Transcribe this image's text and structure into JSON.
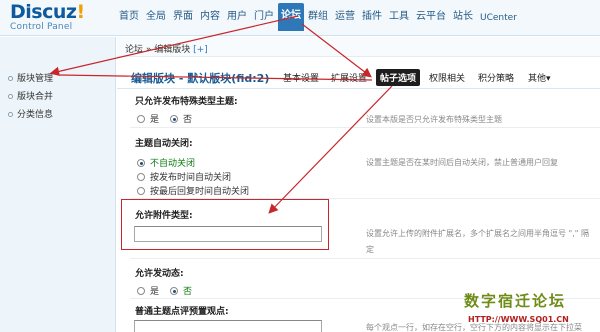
{
  "logo": {
    "main": "Discuz",
    "bang": "!",
    "sub": "Control Panel"
  },
  "topnav": [
    "首页",
    "全局",
    "界面",
    "内容",
    "用户",
    "门户",
    "论坛",
    "群组",
    "运营",
    "插件",
    "工具",
    "云平台",
    "站长",
    "UCenter"
  ],
  "sidebar": {
    "items": [
      "版块管理",
      "版块合并",
      "分类信息"
    ]
  },
  "breadcrumb": {
    "path": "论坛 » 编辑版块",
    "plus": "[+]"
  },
  "page_title": "编辑版块 - 默认版块(fid:2)",
  "tabs": [
    "基本设置",
    "扩展设置",
    "帖子选项",
    "权限相关",
    "积分策略",
    "其他▾"
  ],
  "form": {
    "special_type": {
      "label": "只允许发布特殊类型主题:",
      "yes": "是",
      "no": "否",
      "desc": "设置本版是否只允许发布特殊类型主题"
    },
    "auto_close": {
      "label": "主题自动关闭:",
      "options": [
        "不自动关闭",
        "按发布时间自动关闭",
        "按最后回复时间自动关闭"
      ],
      "desc": "设置主题是否在某时间后自动关闭，禁止普通用户回复"
    },
    "attach_types": {
      "label": "允许附件类型:",
      "value": "",
      "desc": "设置允许上传的附件扩展名，多个扩展名之间用半角逗号 \",\" 隔",
      "desc2": "定"
    },
    "allow_feed": {
      "label": "允许发动态:",
      "yes": "是",
      "no": "否"
    },
    "viewpoints": {
      "label": "普通主题点评预置观点:",
      "desc": "每个观点一行，如存在空行，空行下方的内容将显示在下拉菜"
    }
  },
  "watermark": {
    "title": "数字宿迁论坛",
    "url": "HTTP://WWW.SQ01.CN"
  },
  "colors": {
    "annotation_red": "#c7262a",
    "active_nav": "#2f78b8",
    "active_tab": "#1d1d1d",
    "selected_option": "#0d7a10"
  }
}
